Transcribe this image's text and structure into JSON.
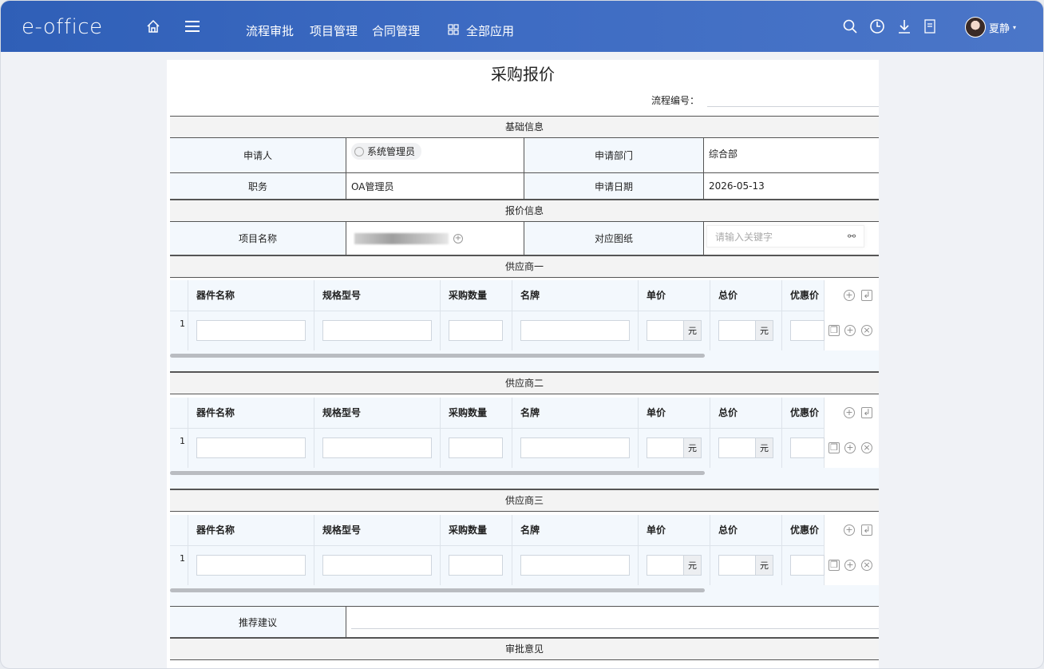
{
  "app": {
    "logo": "e-office"
  },
  "topnav": [
    "流程审批",
    "项目管理",
    "合同管理",
    "全部应用"
  ],
  "user": {
    "name": "夏静"
  },
  "form": {
    "title": "采购报价",
    "flow_no_label": "流程编号：",
    "section_basic": "基础信息",
    "applicant_label": "申请人",
    "applicant_value": "系统管理员",
    "dept_label": "申请部门",
    "dept_value": "综合部",
    "position_label": "职务",
    "position_value": "OA管理员",
    "date_label": "申请日期",
    "date_value": "2026-05-13",
    "section_quote": "报价信息",
    "project_label": "项目名称",
    "drawing_label": "对应图纸",
    "drawing_placeholder": "请输入关键字",
    "suppliers": [
      {
        "title": "供应商一",
        "row": "1"
      },
      {
        "title": "供应商二",
        "row": "1"
      },
      {
        "title": "供应商三",
        "row": "1"
      }
    ],
    "columns": [
      "器件名称",
      "规格型号",
      "采购数量",
      "名牌",
      "单价",
      "总价",
      "优惠价"
    ],
    "currency": "元",
    "recommend_label": "推荐建议",
    "section_approval": "审批意见"
  }
}
